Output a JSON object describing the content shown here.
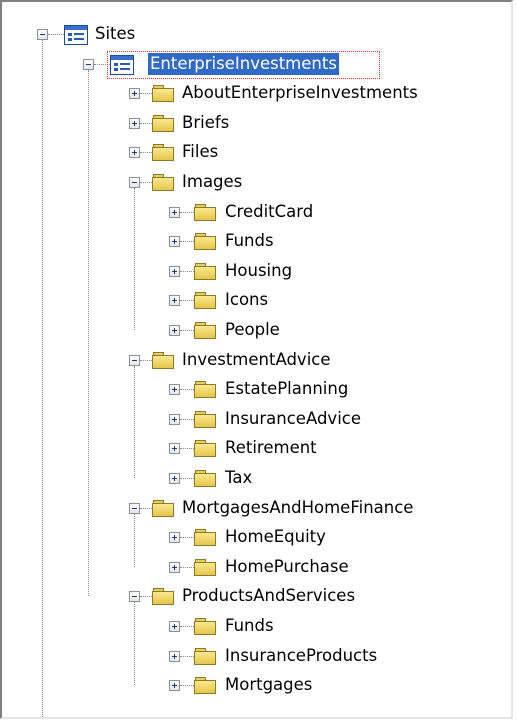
{
  "tree": {
    "root": {
      "label": "Sites",
      "icon": "site-icon"
    },
    "site": {
      "label": "EnterpriseInvestments",
      "icon": "site-icon",
      "selected": true
    },
    "folders": [
      {
        "label": "AboutEnterpriseInvestments",
        "expanded": false
      },
      {
        "label": "Briefs",
        "expanded": false
      },
      {
        "label": "Files",
        "expanded": false
      },
      {
        "label": "Images",
        "expanded": true,
        "children": [
          "CreditCard",
          "Funds",
          "Housing",
          "Icons",
          "People"
        ]
      },
      {
        "label": "InvestmentAdvice",
        "expanded": true,
        "children": [
          "EstatePlanning",
          "InsuranceAdvice",
          "Retirement",
          "Tax"
        ]
      },
      {
        "label": "MortgagesAndHomeFinance",
        "expanded": true,
        "children": [
          "HomeEquity",
          "HomePurchase"
        ]
      },
      {
        "label": "ProductsAndServices",
        "expanded": true,
        "children": [
          "Funds",
          "InsuranceProducts",
          "Mortgages"
        ]
      }
    ]
  },
  "colors": {
    "selection": "#316ac5",
    "folder": "#f2d766",
    "site_icon": "#2a5ab7"
  }
}
